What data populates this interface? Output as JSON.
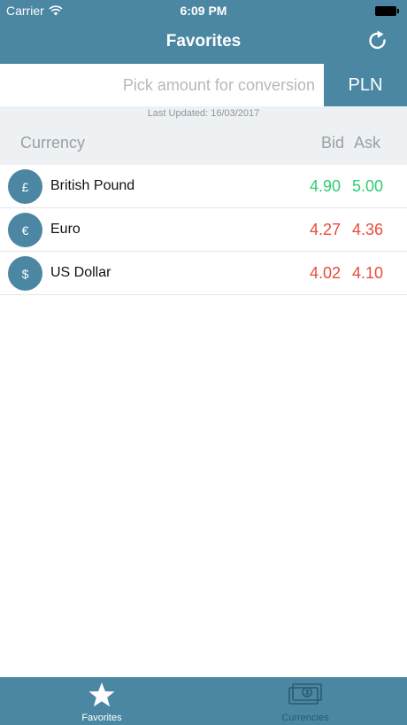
{
  "status_bar": {
    "carrier": "Carrier",
    "time": "6:09 PM"
  },
  "nav": {
    "title": "Favorites",
    "refresh_icon": "refresh-icon"
  },
  "conversion": {
    "amount_value": "",
    "amount_placeholder": "Pick amount for conversion",
    "base_currency": "PLN"
  },
  "last_updated": "Last Updated: 16/03/2017",
  "table_header": {
    "currency": "Currency",
    "bid": "Bid",
    "ask": "Ask"
  },
  "rates": [
    {
      "symbol": "£",
      "name": "British Pound",
      "bid": "4.90",
      "ask": "5.00",
      "bid_color": "#2ecc71",
      "ask_color": "#2ecc71"
    },
    {
      "symbol": "€",
      "name": "Euro",
      "bid": "4.27",
      "ask": "4.36",
      "bid_color": "#e74c3c",
      "ask_color": "#e74c3c"
    },
    {
      "symbol": "$",
      "name": "US Dollar",
      "bid": "4.02",
      "ask": "4.10",
      "bid_color": "#e74c3c",
      "ask_color": "#e74c3c"
    }
  ],
  "tabbar": {
    "items": [
      {
        "label": "Favorites",
        "icon": "star-icon",
        "active": true,
        "color": "#ffffff"
      },
      {
        "label": "Currencies",
        "icon": "banknote-icon",
        "active": false,
        "color": "#2b5a70"
      }
    ]
  },
  "colors": {
    "brand": "#4b87a3",
    "header_bg": "#eef1f3",
    "up": "#2ecc71",
    "down": "#e74c3c"
  }
}
